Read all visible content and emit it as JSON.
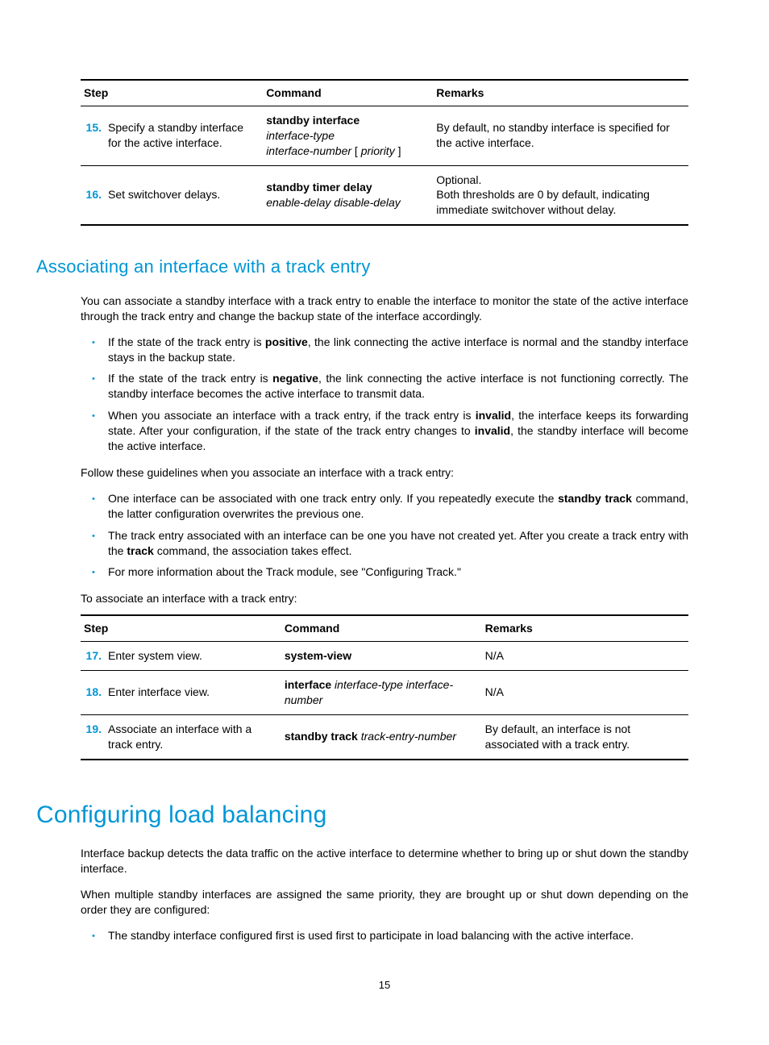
{
  "table1": {
    "headers": {
      "step": "Step",
      "command": "Command",
      "remarks": "Remarks"
    },
    "rows": [
      {
        "num": "15.",
        "step": "Specify a standby interface for the active interface.",
        "cmd_bold": "standby interface",
        "cmd_ital1": "interface-type",
        "cmd_ital2_prefix": "interface-number",
        "cmd_bracket_open": " [ ",
        "cmd_ital2_inner": "priority",
        "cmd_bracket_close": " ]",
        "remarks": "By default, no standby interface is specified for the active interface."
      },
      {
        "num": "16.",
        "step": "Set switchover delays.",
        "cmd_bold": "standby timer delay",
        "cmd_ital1": "enable-delay disable-delay",
        "remarks_l1": "Optional.",
        "remarks_l2": "Both thresholds are 0 by default, indicating immediate switchover without delay."
      }
    ]
  },
  "heading1": "Associating an interface with a track entry",
  "para1": "You can associate a standby interface with a track entry to enable the interface to monitor the state of the active interface through the track entry and change the backup state of the interface accordingly.",
  "bullets1": [
    {
      "pre": "If the state of the track entry is ",
      "b1": "positive",
      "post": ", the link connecting the active interface is normal and the standby interface stays in the backup state."
    },
    {
      "pre": "If the state of the track entry is ",
      "b1": "negative",
      "post": ", the link connecting the active interface is not functioning correctly. The standby interface becomes the active interface to transmit data."
    },
    {
      "pre": "When you associate an interface with a track entry, if the track entry is ",
      "b1": "invalid",
      "mid": ", the interface keeps its forwarding state. After your configuration, if the state of the track entry changes to ",
      "b2": "invalid",
      "post": ", the standby interface will become the active interface."
    }
  ],
  "para2": "Follow these guidelines when you associate an interface with a track entry:",
  "bullets2": [
    {
      "pre": "One interface can be associated with one track entry only. If you repeatedly execute the ",
      "b1": "standby track",
      "post": " command, the latter configuration overwrites the previous one."
    },
    {
      "pre": "The track entry associated with an interface can be one you have not created yet. After you create a track entry with the ",
      "b1": "track",
      "post": " command, the association takes effect."
    },
    {
      "text": "For more information about the Track module, see \"Configuring Track.\""
    }
  ],
  "para3": "To associate an interface with a track entry:",
  "table2": {
    "headers": {
      "step": "Step",
      "command": "Command",
      "remarks": "Remarks"
    },
    "rows": [
      {
        "num": "17.",
        "step": "Enter system view.",
        "cmd_bold": "system-view",
        "remarks": "N/A"
      },
      {
        "num": "18.",
        "step": "Enter interface view.",
        "cmd_bold": "interface",
        "cmd_ital1": " interface-type interface-number",
        "remarks": "N/A"
      },
      {
        "num": "19.",
        "step": "Associate an interface with a track entry.",
        "cmd_bold": "standby track",
        "cmd_ital1": " track-entry-number",
        "remarks": "By default, an interface is not associated with a track entry."
      }
    ]
  },
  "heading2": "Configuring load balancing",
  "para4": "Interface backup detects the data traffic on the active interface to determine whether to bring up or shut down the standby interface.",
  "para5": "When multiple standby interfaces are assigned the same priority, they are brought up or shut down depending on the order they are configured:",
  "bullets3": [
    {
      "text": "The standby interface configured first is used first to participate in load balancing with the active interface."
    }
  ],
  "pagenum": "15"
}
